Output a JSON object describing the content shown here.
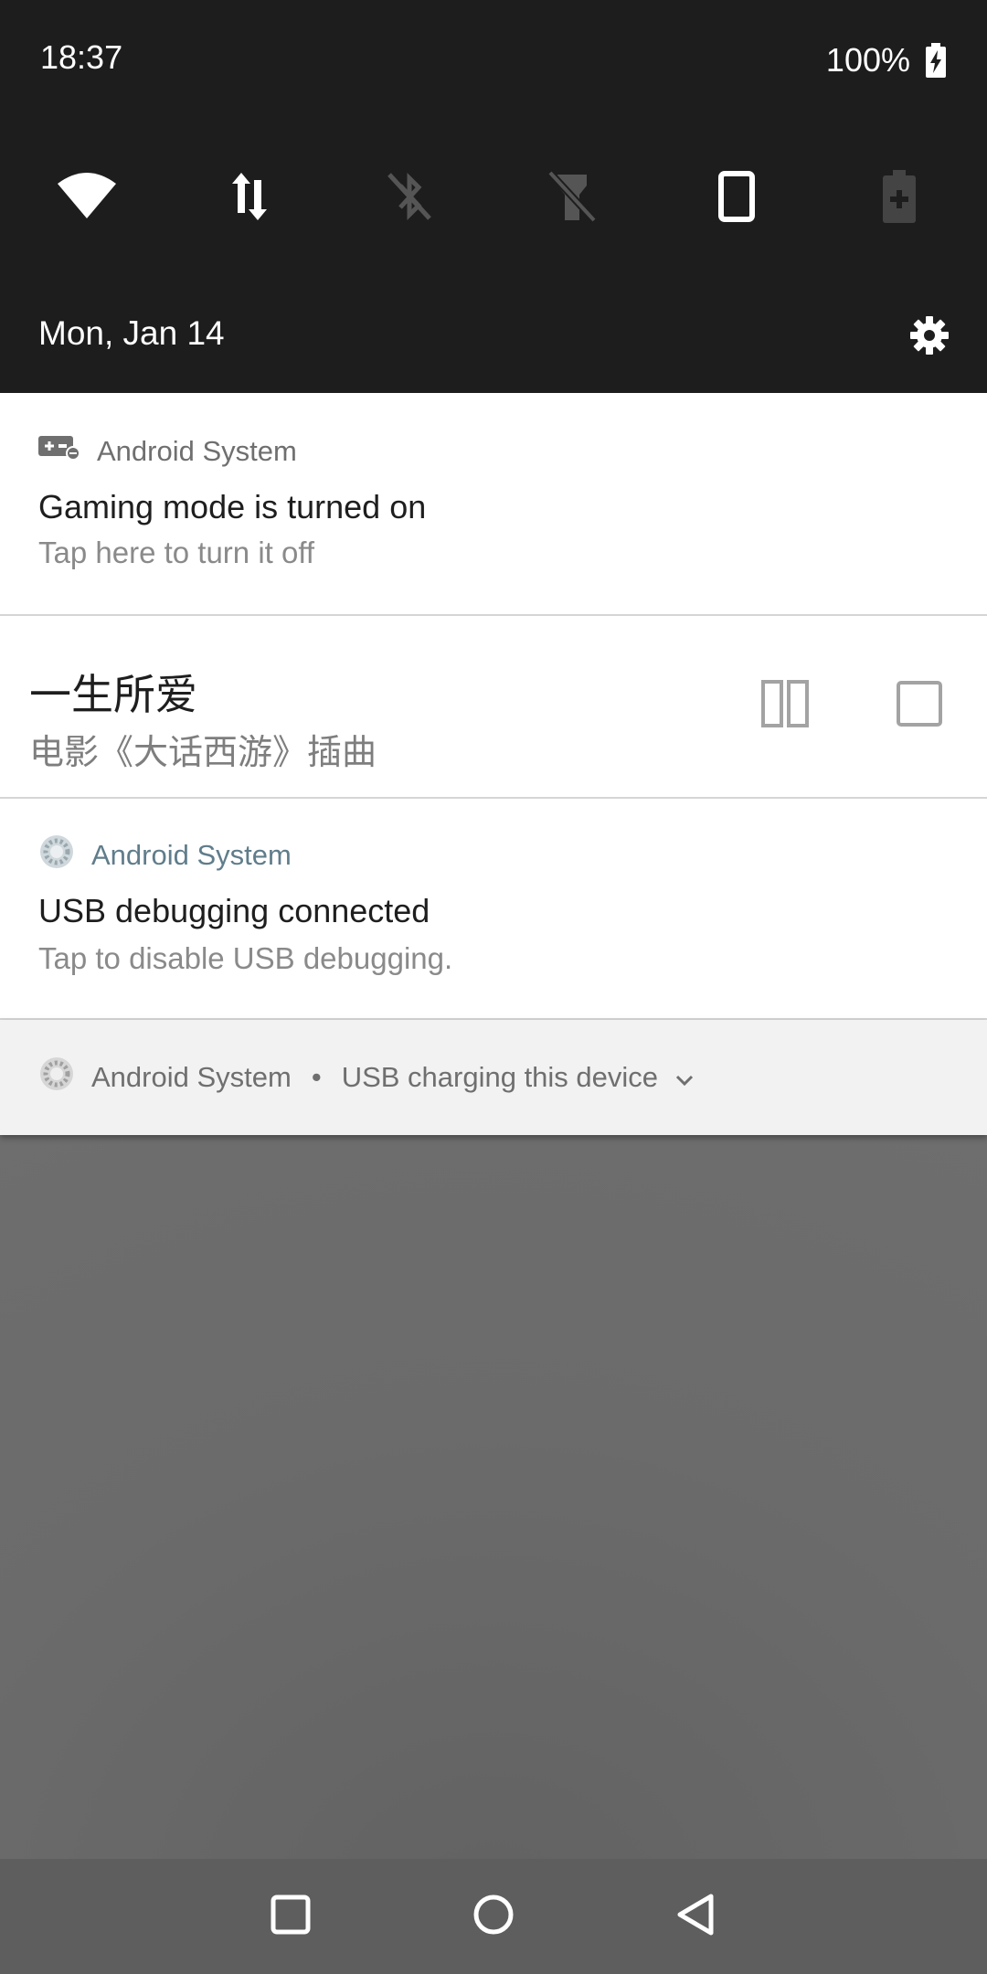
{
  "status_bar": {
    "time": "18:37",
    "battery_percent": "100%"
  },
  "quick_settings": {
    "tiles": [
      {
        "icon": "wifi-icon",
        "active": true
      },
      {
        "icon": "mobile-data-icon",
        "active": true
      },
      {
        "icon": "bluetooth-off-icon",
        "active": false
      },
      {
        "icon": "flashlight-off-icon",
        "active": false
      },
      {
        "icon": "auto-rotate-icon",
        "active": true
      },
      {
        "icon": "battery-saver-icon",
        "active": false
      }
    ],
    "date": "Mon, Jan 14"
  },
  "notifications": [
    {
      "app": "Android System",
      "icon": "gamepad-icon",
      "title": "Gaming mode is turned on",
      "text": "Tap here to turn it off"
    },
    {
      "type": "media",
      "title": "一生所爱",
      "subtitle": "电影《大话西游》插曲"
    },
    {
      "app": "Android System",
      "icon": "android-system-icon",
      "title": "USB debugging connected",
      "text": "Tap to disable USB debugging."
    }
  ],
  "collapsed_notification": {
    "app": "Android System",
    "separator": "•",
    "text": "USB charging this device"
  },
  "colors": {
    "shade": "#1d1d1d",
    "accent_app_name": "#607d8b",
    "scrim": "#6b6b6b"
  }
}
